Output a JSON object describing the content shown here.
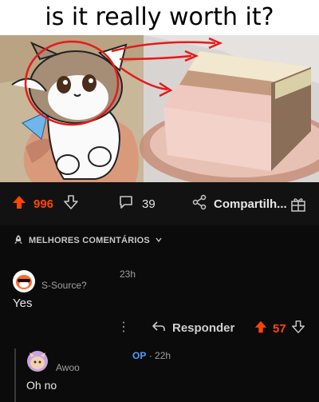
{
  "meme": {
    "title": "is it really worth it?"
  },
  "post_actions": {
    "upvotes": "996",
    "comments": "39",
    "share_label": "Compartilh..."
  },
  "sort": {
    "label": "MELHORES COMENTÁRIOS"
  },
  "comments": [
    {
      "author": "S-Source?",
      "time": "23h",
      "body": "Yes",
      "reply_label": "Responder",
      "score": "57"
    },
    {
      "author": "Awoo",
      "op_badge": "OP",
      "time": "· 22h",
      "body": "Oh no"
    }
  ],
  "colors": {
    "upvote": "#ff4500",
    "op_badge": "#4f9cff",
    "background": "#0b0b0b"
  }
}
